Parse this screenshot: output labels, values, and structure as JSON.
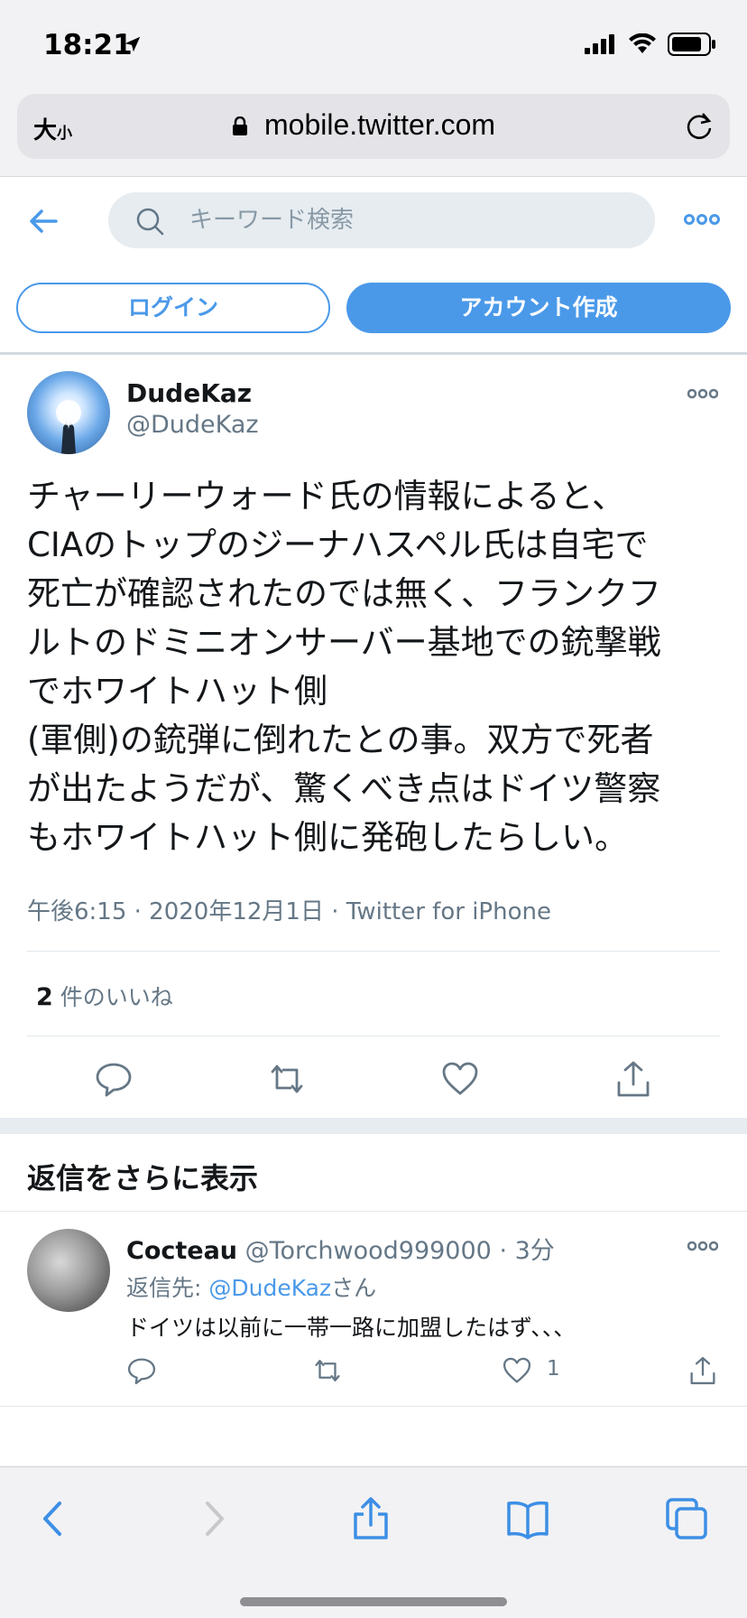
{
  "status_bar": {
    "time": "18:21",
    "icons": [
      "location-arrow-icon",
      "cellular-signal-icon",
      "wifi-icon",
      "battery-icon"
    ]
  },
  "browser": {
    "text_size_label": "大",
    "text_size_small": "小",
    "url": "mobile.twitter.com",
    "icons": [
      "lock-icon",
      "reload-icon"
    ]
  },
  "header": {
    "search_placeholder": "キーワード検索",
    "icons": [
      "back-arrow-icon",
      "search-icon",
      "more-icon"
    ]
  },
  "auth": {
    "login_label": "ログイン",
    "signup_label": "アカウント作成"
  },
  "tweet": {
    "author_name": "DudeKaz",
    "author_handle": "@DudeKaz",
    "text": "チャーリーウォード氏の情報によると、\nCIAのトップのジーナハスペル氏は自宅で\n死亡が確認されたのでは無く、フランクフ\nルトのドミニオンサーバー基地での銃撃戦\nでホワイトハット側\n(軍側)の銃弾に倒れたとの事。双方で死者\nが出たようだが、驚くべき点はドイツ警察\nもホワイトハット側に発砲したらしい。",
    "meta": "午後6:15 · 2020年12月1日 · Twitter for iPhone",
    "like_count": "2",
    "like_label": "件のいいね",
    "actions": [
      "reply-icon",
      "retweet-icon",
      "like-icon",
      "share-icon"
    ]
  },
  "more_replies": {
    "title": "返信をさらに表示"
  },
  "reply": {
    "name": "Cocteau",
    "handle": "@Torchwood999000",
    "time": "3分",
    "reply_to_prefix": "返信先: ",
    "reply_to_mention": "@DudeKaz",
    "reply_to_suffix": "さん",
    "text": "ドイツは以前に一帯一路に加盟したはず、、、",
    "like_count": "1"
  },
  "bottom_toolbar": {
    "icons": [
      "back-icon",
      "forward-icon",
      "share-icon",
      "bookmarks-icon",
      "tabs-icon"
    ]
  },
  "colors": {
    "twitter_blue": "#4a99e9",
    "secondary_text": "#657786",
    "ios_blue": "#3d8fe5"
  }
}
